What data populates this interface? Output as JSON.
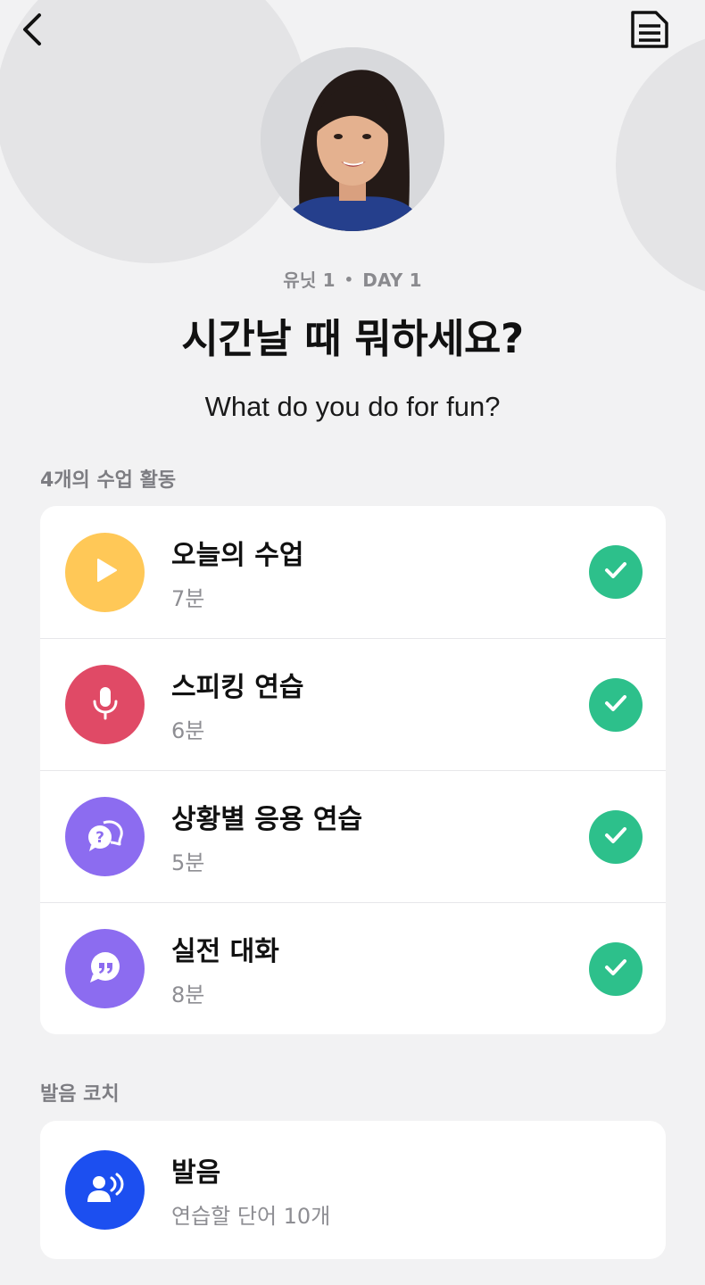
{
  "header": {
    "unit": "유닛 1",
    "separator": "•",
    "day": "DAY 1",
    "title": "시간날 때 뭐하세요?",
    "subtitle": "What do you do for fun?"
  },
  "activities": {
    "section_label": "4개의 수업 활동",
    "items": [
      {
        "title": "오늘의 수업",
        "duration": "7분",
        "icon": "play-icon",
        "color": "#ffc857",
        "completed": true
      },
      {
        "title": "스피킹 연습",
        "duration": "6분",
        "icon": "microphone-icon",
        "color": "#e04a66",
        "completed": true
      },
      {
        "title": "상황별 응용 연습",
        "duration": "5분",
        "icon": "question-bubbles-icon",
        "color": "#8c6cf0",
        "completed": true
      },
      {
        "title": "실전 대화",
        "duration": "8분",
        "icon": "quote-bubble-icon",
        "color": "#8c6cf0",
        "completed": true
      }
    ]
  },
  "pronunciation": {
    "section_label": "발음 코치",
    "item": {
      "title": "발음",
      "subtitle": "연습할 단어 10개",
      "icon": "speaking-person-icon",
      "color": "#1c4ff0"
    }
  },
  "icons": {
    "back": "chevron-left-icon",
    "notes": "document-icon",
    "completed": "checkmark-icon"
  }
}
